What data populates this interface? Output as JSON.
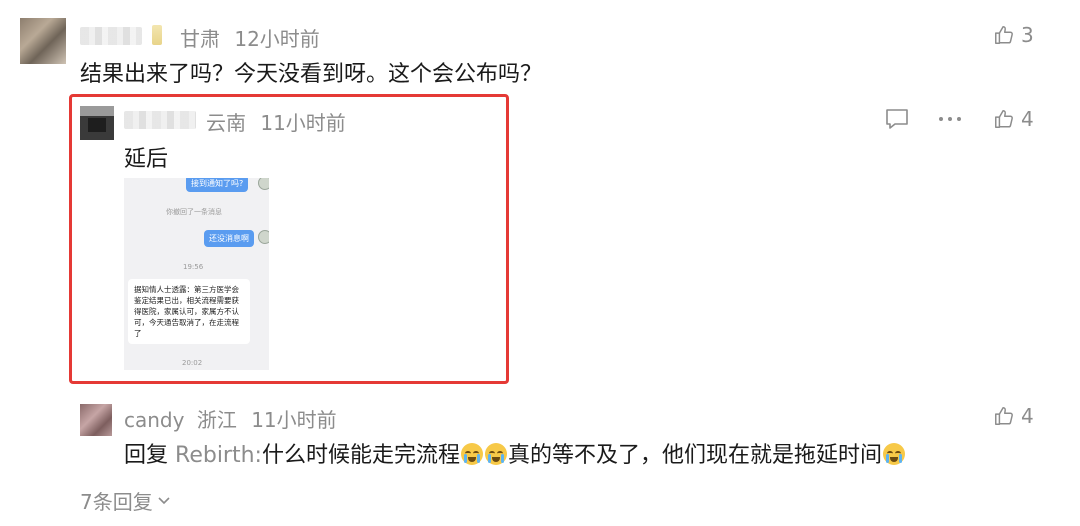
{
  "comments": [
    {
      "location": "甘肃",
      "time": "12小时前",
      "text": "结果出来了吗？今天没看到呀。这个会公布吗？",
      "likes": "3",
      "like_icon": "thumbs-up-icon"
    }
  ],
  "replies": [
    {
      "location": "云南",
      "time": "11小时前",
      "text": "延后",
      "likes": "4",
      "comment_icon": "comment-icon",
      "more_icon": "more-icon",
      "image": {
        "msg_top": "接到通知了吗?",
        "recall_notice": "你撤回了一条消息",
        "msg_mid": "还没消息啊",
        "time1": "19:56",
        "msg_bottom": "据知情人士透露：第三方医学会鉴定结果已出，相关流程需要获得医院，家属认可，家属方不认可，今天通告取消了，在走流程了",
        "time2": "20:02"
      },
      "highlight_color": "#e53935"
    },
    {
      "username": "candy",
      "location": "浙江",
      "time": "11小时前",
      "reply_prefix": "回复",
      "reply_to": "Rebirth",
      "reply_sep": ":",
      "text_part1": "什么时候能走完流程",
      "text_part2": "真的等不及了，他们现在就是拖延时间",
      "emoji_icon": "loudly-crying-face-icon",
      "likes": "4"
    }
  ],
  "more_replies": "7条回复",
  "more_replies_icon": "chevron-down-icon"
}
